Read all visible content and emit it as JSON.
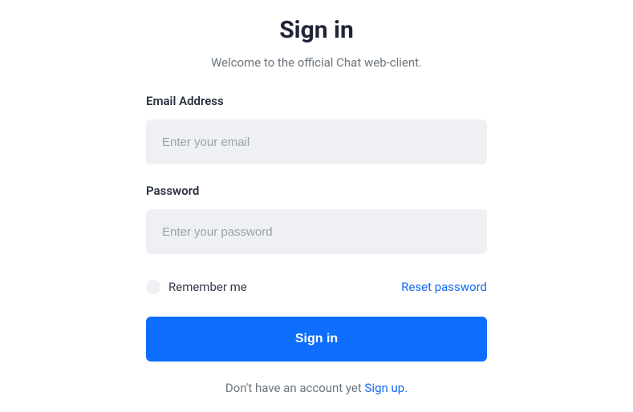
{
  "header": {
    "title": "Sign in",
    "subtitle": "Welcome to the official Chat web-client."
  },
  "form": {
    "email": {
      "label": "Email Address",
      "placeholder": "Enter your email",
      "value": ""
    },
    "password": {
      "label": "Password",
      "placeholder": "Enter your password",
      "value": ""
    },
    "remember_label": "Remember me",
    "reset_link": "Reset password",
    "submit_label": "Sign in"
  },
  "footer": {
    "prompt": "Don't have an account yet ",
    "signup_link": "Sign up."
  },
  "colors": {
    "primary": "#0d6efd",
    "link": "#176bef",
    "input_bg": "#eef0f4",
    "muted_text": "#6c757d",
    "heading_text": "#202436"
  }
}
